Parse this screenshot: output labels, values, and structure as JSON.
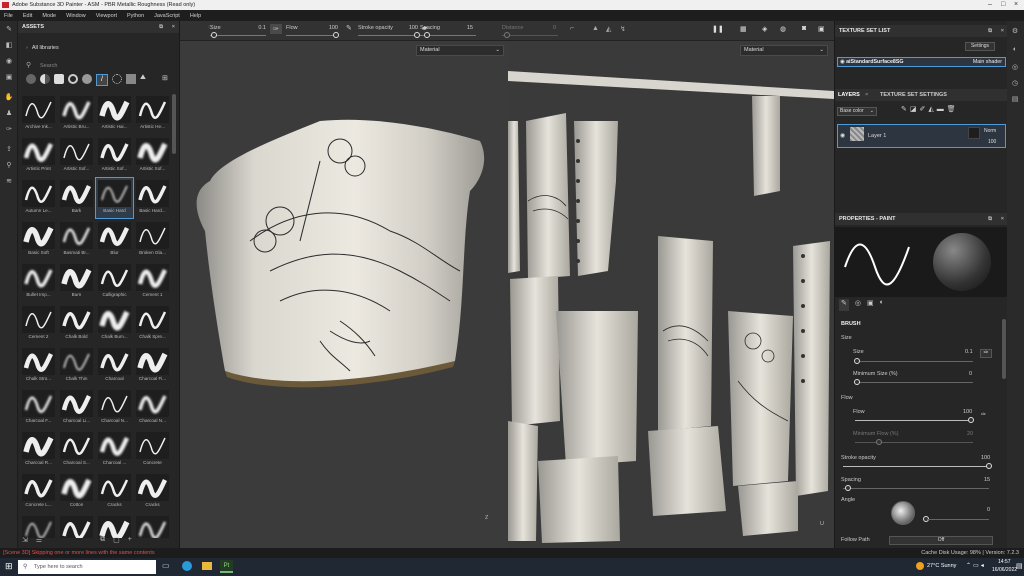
{
  "window": {
    "title": "Adobe Substance 3D Painter - ASM - PBR Metallic Roughness (Read only)"
  },
  "menu": [
    "File",
    "Edit",
    "Mode",
    "Window",
    "Viewport",
    "Python",
    "JavaScript",
    "Help"
  ],
  "toolbar": {
    "size_label": "Size",
    "size_value": "0.1",
    "flow_label": "Flow",
    "flow_value": "100",
    "stroke_opacity_label": "Stroke opacity",
    "stroke_opacity_value": "100",
    "spacing_label": "Spacing",
    "spacing_value": "15",
    "distance_label": "Distance",
    "distance_value": "0"
  },
  "assets": {
    "title": "ASSETS",
    "library": "All libraries",
    "search_placeholder": "Search",
    "brushes": [
      "Archive Ink...",
      "Artistic Bru...",
      "Artistic Hai...",
      "Artistic He...",
      "Artistic Print",
      "Artistic Sof...",
      "Artistic Sof...",
      "Artistic Sof...",
      "Autumn Le...",
      "Bark",
      "Basic Hard",
      "Basic Hard...",
      "Basic Soft",
      "Basmati Br...",
      "Blur",
      "Broken Gla...",
      "Bullet Imp...",
      "Burn",
      "Calligraphic",
      "Cement 1",
      "Cement 2",
      "Chalk Bold",
      "Chalk Bum...",
      "Chalk Spre...",
      "Chalk Stro...",
      "Chalk Thin",
      "Charcoal",
      "Charcoal Fi...",
      "Charcoal F...",
      "Charcoal Li...",
      "Charcoal N...",
      "Charcoal N...",
      "Charcoal R...",
      "Charcoal S...",
      "Charcoal ...",
      "Concrete",
      "Concrete L...",
      "Cotton",
      "Cracks",
      "Cracks",
      "",
      "",
      "",
      ""
    ],
    "selected_index": 10
  },
  "viewports": {
    "left_dropdown": "Material",
    "right_dropdown": "Material"
  },
  "texture_set_list": {
    "title": "TEXTURE SET LIST",
    "settings_label": "Settings",
    "item_name": "aiStandardSurface8SG",
    "shader": "Main shader"
  },
  "layers": {
    "tab_layers": "LAYERS",
    "tab_texture_settings": "TEXTURE SET SETTINGS",
    "channel": "Base color",
    "layer_name": "Layer 1",
    "blend": "Norm",
    "opacity": "100"
  },
  "properties": {
    "title": "PROPERTIES - PAINT",
    "brush_header": "BRUSH",
    "size_group": "Size",
    "size_label": "Size",
    "size_value": "0.1",
    "min_size_label": "Minimum Size (%)",
    "min_size_value": "0",
    "flow_group": "Flow",
    "flow_label": "Flow",
    "flow_value": "100",
    "min_flow_label": "Minimum Flow (%)",
    "min_flow_value": "20",
    "stroke_opacity_label": "Stroke opacity",
    "stroke_opacity_value": "100",
    "spacing_label": "Spacing",
    "spacing_value": "15",
    "angle_label": "Angle",
    "angle_value": "0",
    "follow_path_label": "Follow Path",
    "follow_path_value": "Off"
  },
  "status": {
    "message": "[Scene 3D] Skipping one or more lines with the same contents",
    "cache": "Cache Disk Usage: 98% | Version: 7.2.3"
  },
  "taskbar": {
    "search_placeholder": "Type here to search",
    "weather": "27°C  Sunny",
    "time": "14:57",
    "date": "16/06/2022"
  },
  "colors": {
    "accent": "#4f9ad8",
    "error": "#e05050"
  }
}
